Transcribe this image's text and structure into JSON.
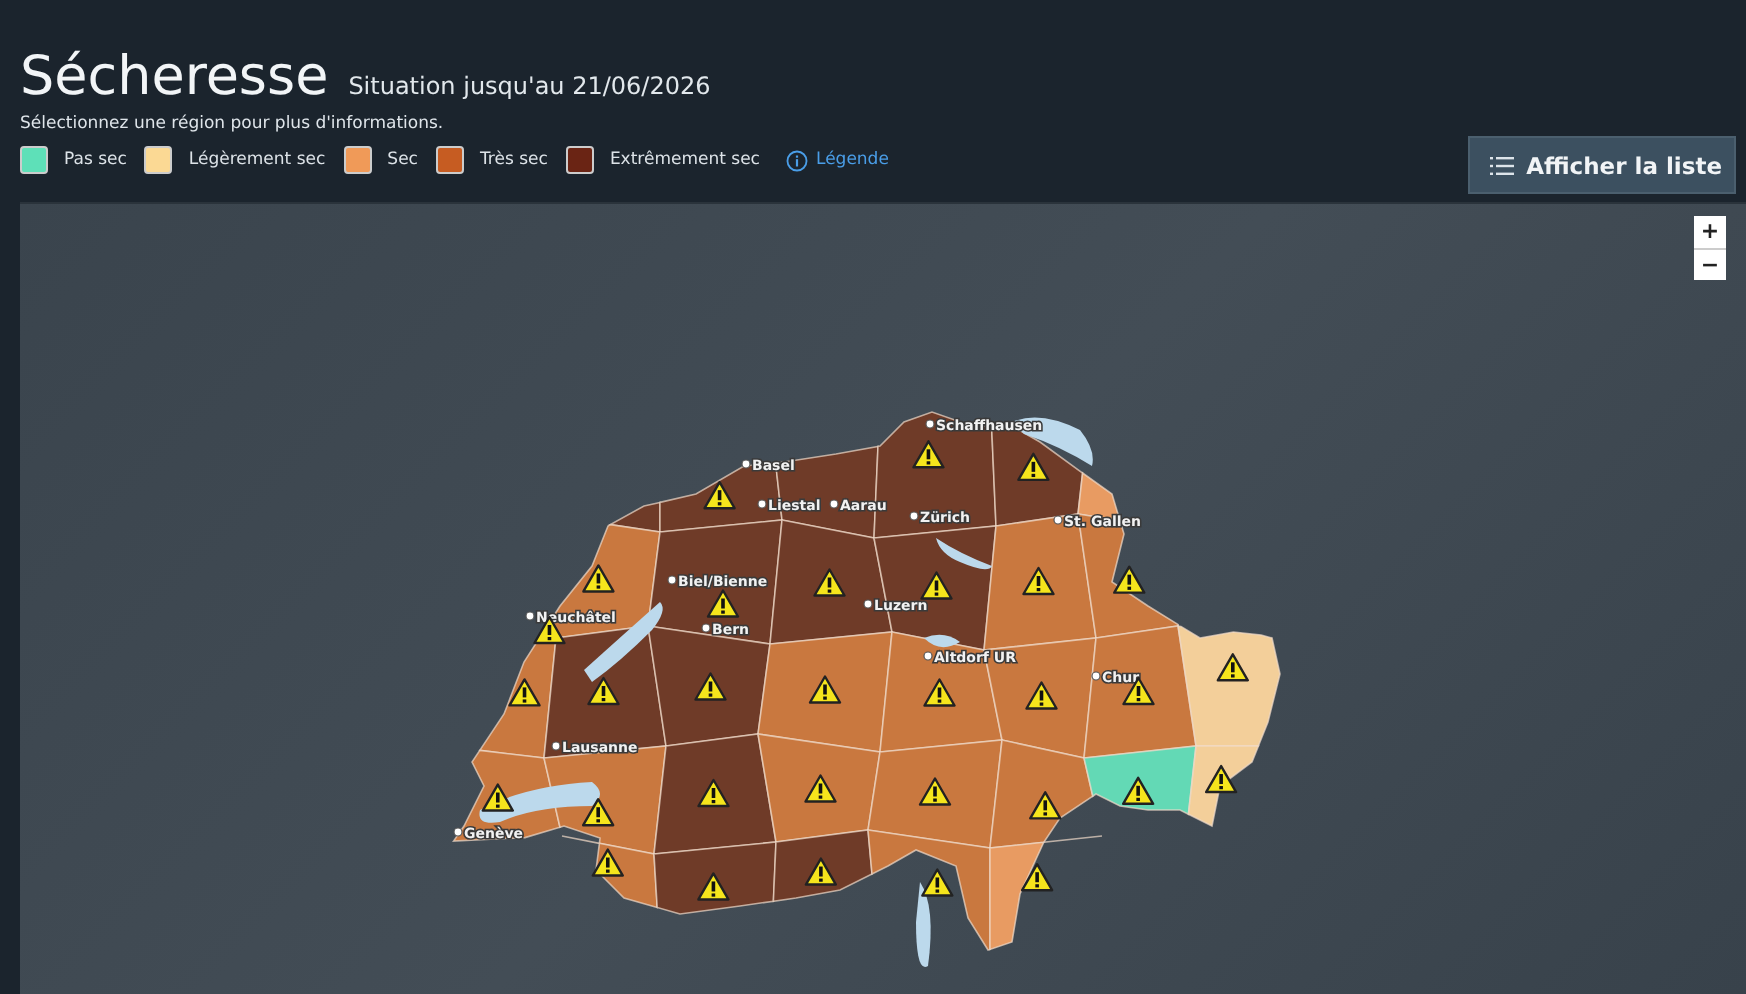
{
  "header": {
    "title": "Sécheresse",
    "subtitle": "Situation jusqu'au 21/06/2026",
    "instruction": "Sélectionnez une région pour plus d'informations."
  },
  "legend": {
    "items": [
      {
        "label": "Pas sec",
        "color": "#5ee0b8"
      },
      {
        "label": "Légèrement sec",
        "color": "#fbd994"
      },
      {
        "label": "Sec",
        "color": "#f09a58"
      },
      {
        "label": "Très sec",
        "color": "#c65c22"
      },
      {
        "label": "Extrêmement sec",
        "color": "#6a2414"
      }
    ],
    "link": "Légende"
  },
  "list_button": "Afficher la liste",
  "zoom": {
    "in": "+",
    "out": "−"
  },
  "map": {
    "regions": [
      {
        "kind": "extreme",
        "warning": false
      },
      {
        "kind": "extreme",
        "warning": true
      },
      {
        "kind": "extreme",
        "warning": false
      },
      {
        "kind": "extreme",
        "warning": true
      },
      {
        "kind": "extreme",
        "warning": true
      },
      {
        "kind": "dry",
        "warning": false
      },
      {
        "kind": "very",
        "warning": true
      },
      {
        "kind": "very",
        "warning": true
      },
      {
        "kind": "extreme",
        "warning": true
      },
      {
        "kind": "extreme",
        "warning": true
      },
      {
        "kind": "extreme",
        "warning": true
      },
      {
        "kind": "very",
        "warning": true
      },
      {
        "kind": "very",
        "warning": true
      },
      {
        "kind": "very",
        "warning": true
      },
      {
        "kind": "extreme",
        "warning": true
      },
      {
        "kind": "extreme",
        "warning": true
      },
      {
        "kind": "very",
        "warning": true
      },
      {
        "kind": "very",
        "warning": true
      },
      {
        "kind": "very",
        "warning": true
      },
      {
        "kind": "very",
        "warning": true
      },
      {
        "kind": "slight",
        "warning": true
      },
      {
        "kind": "very",
        "warning": true
      },
      {
        "kind": "very",
        "warning": true
      },
      {
        "kind": "extreme",
        "warning": true
      },
      {
        "kind": "very",
        "warning": true
      },
      {
        "kind": "very",
        "warning": true
      },
      {
        "kind": "very",
        "warning": true
      },
      {
        "kind": "none",
        "warning": true
      },
      {
        "kind": "slight",
        "warning": true
      },
      {
        "kind": "very",
        "warning": true
      },
      {
        "kind": "extreme",
        "warning": true
      },
      {
        "kind": "extreme",
        "warning": true
      },
      {
        "kind": "very",
        "warning": true
      },
      {
        "kind": "dry",
        "warning": true
      }
    ],
    "cities": [
      "Schaffhausen",
      "Basel",
      "Liestal",
      "Aarau",
      "Zürich",
      "St. Gallen",
      "Biel/Bienne",
      "Neuchâtel",
      "Bern",
      "Luzern",
      "Altdorf UR",
      "Chur",
      "Lausanne",
      "Genève"
    ]
  }
}
